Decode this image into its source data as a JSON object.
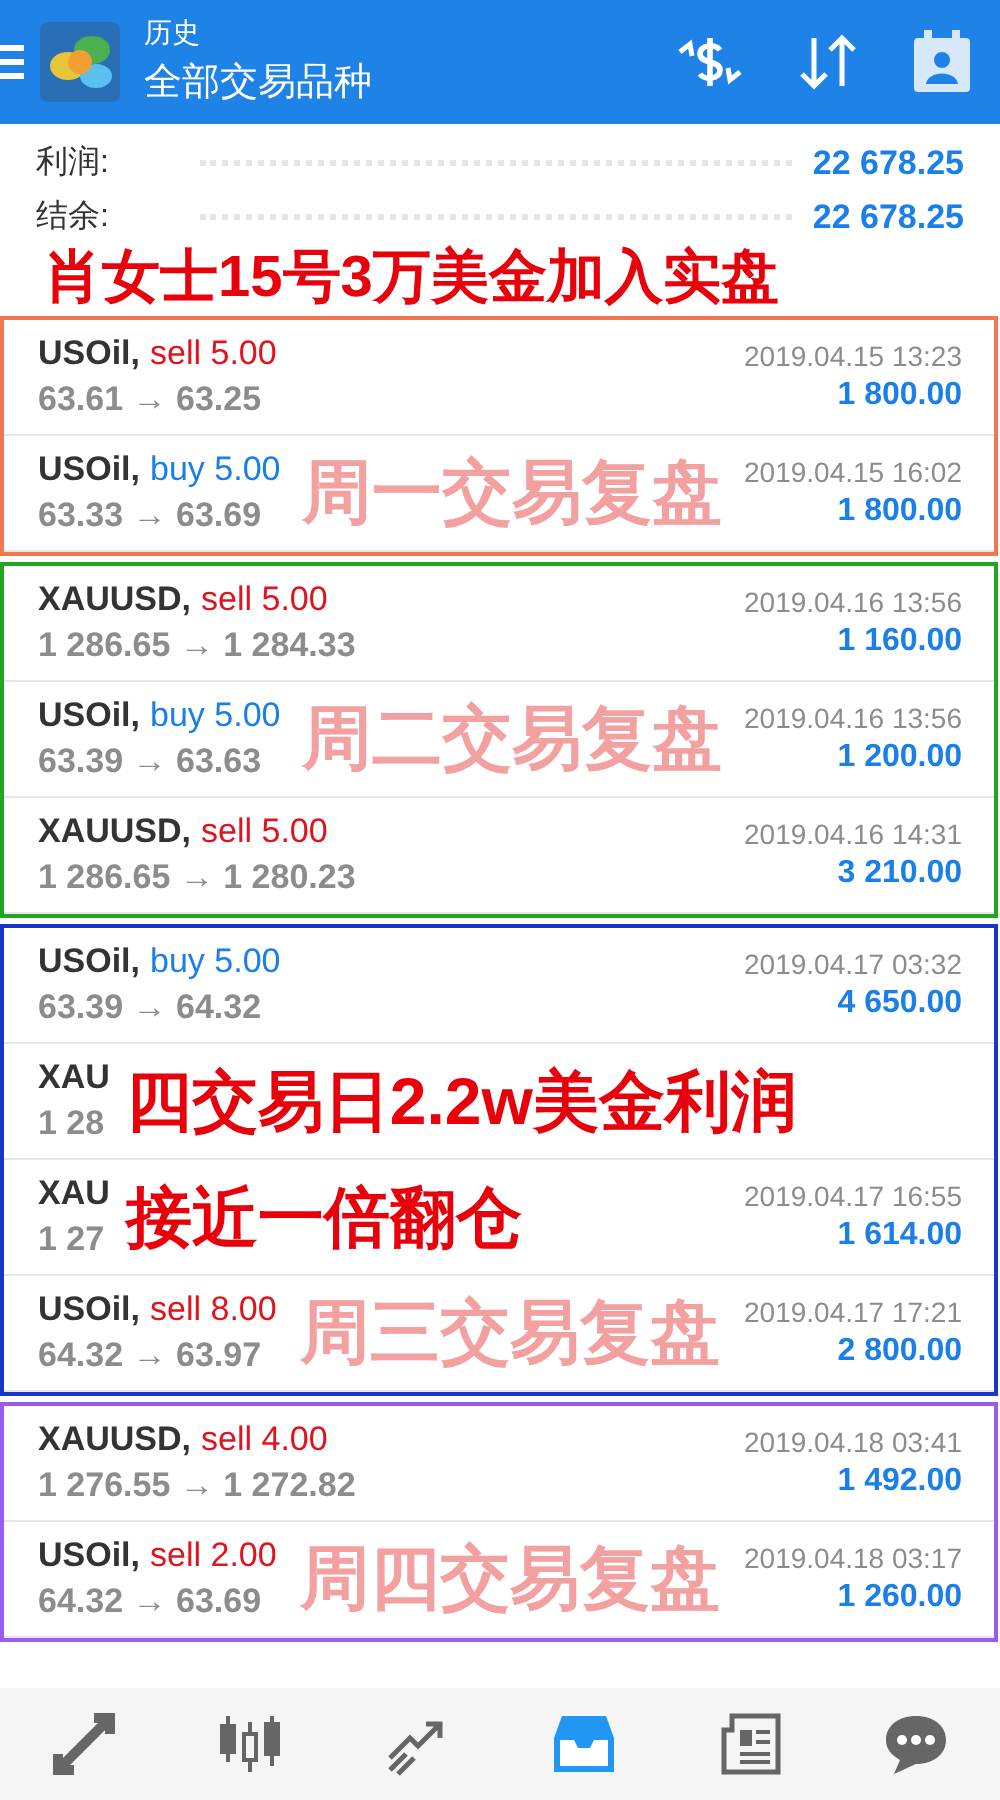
{
  "header": {
    "title": "历史",
    "subtitle": "全部交易品种"
  },
  "summary": [
    {
      "label": "利润:",
      "value": "22 678.25"
    },
    {
      "label": "结余:",
      "value": "22 678.25"
    }
  ],
  "headline": "肖女士15号3万美金加入实盘",
  "groups": [
    {
      "color": "#f07850",
      "trades": [
        {
          "symbol": "USOil,",
          "kind": "sell",
          "action": "sell 5.00",
          "prices": "63.61 → 63.25",
          "time": "2019.04.15 13:23",
          "profit": "1 800.00"
        },
        {
          "symbol": "USOil,",
          "kind": "buy",
          "action": "buy 5.00",
          "prices": "63.33 → 63.69",
          "time": "2019.04.15 16:02",
          "profit": "1 800.00",
          "overlay": {
            "kind": "caption",
            "text": "周一交易复盘"
          }
        }
      ]
    },
    {
      "color": "#1fa81f",
      "trades": [
        {
          "symbol": "XAUUSD,",
          "kind": "sell",
          "action": "sell 5.00",
          "prices": "1 286.65 → 1 284.33",
          "time": "2019.04.16 13:56",
          "profit": "1 160.00"
        },
        {
          "symbol": "USOil,",
          "kind": "buy",
          "action": "buy 5.00",
          "prices": "63.39 → 63.63",
          "time": "2019.04.16 13:56",
          "profit": "1 200.00",
          "overlay": {
            "kind": "caption",
            "text": "周二交易复盘"
          }
        },
        {
          "symbol": "XAUUSD,",
          "kind": "sell",
          "action": "sell 5.00",
          "prices": "1 286.65 → 1 280.23",
          "time": "2019.04.16 14:31",
          "profit": "3 210.00"
        }
      ]
    },
    {
      "color": "#1a35c8",
      "trades": [
        {
          "symbol": "USOil,",
          "kind": "buy",
          "action": "buy 5.00",
          "prices": "63.39 → 64.32",
          "time": "2019.04.17 03:32",
          "profit": "4 650.00"
        },
        {
          "symbol": "XAU",
          "prices": "1 28",
          "overlay": {
            "kind": "callout",
            "text": "四交易日2.2w美金利润"
          }
        },
        {
          "symbol": "XAU",
          "prices": "1 27",
          "time": "2019.04.17 16:55",
          "profit": "1 614.00",
          "overlay": {
            "kind": "callout",
            "text": "接近一倍翻仓"
          }
        },
        {
          "symbol": "USOil,",
          "kind": "sell",
          "action": "sell 8.00",
          "prices": "64.32 → 63.97",
          "time": "2019.04.17 17:21",
          "profit": "2 800.00",
          "overlay": {
            "kind": "caption",
            "text": "周三交易复盘"
          }
        }
      ]
    },
    {
      "color": "#9a5cf0",
      "trades": [
        {
          "symbol": "XAUUSD,",
          "kind": "sell",
          "action": "sell 4.00",
          "prices": "1 276.55 → 1 272.82",
          "time": "2019.04.18 03:41",
          "profit": "1 492.00"
        },
        {
          "symbol": "USOil,",
          "kind": "sell",
          "action": "sell 2.00",
          "prices": "64.32 → 63.69",
          "time": "2019.04.18 03:17",
          "profit": "1 260.00",
          "overlay": {
            "kind": "caption",
            "text": "周四交易复盘"
          }
        }
      ]
    }
  ],
  "nav": [
    {
      "kind": "trade",
      "selected": false
    },
    {
      "kind": "quotes",
      "selected": false
    },
    {
      "kind": "chart",
      "selected": false
    },
    {
      "kind": "history",
      "selected": true
    },
    {
      "kind": "news",
      "selected": false
    },
    {
      "kind": "chat",
      "selected": false
    }
  ]
}
